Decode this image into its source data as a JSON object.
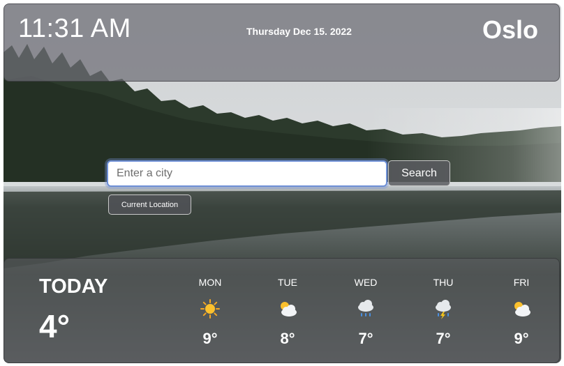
{
  "header": {
    "time": "11:31 AM",
    "date": "Thursday Dec 15. 2022",
    "city": "Oslo"
  },
  "search": {
    "placeholder": "Enter a city",
    "value": "",
    "button_label": "Search",
    "location_button_label": "Current Location"
  },
  "today": {
    "label": "TODAY",
    "temp": "4°"
  },
  "forecast": [
    {
      "day": "MON",
      "icon": "sun-icon",
      "temp": "9°"
    },
    {
      "day": "TUE",
      "icon": "sun-behind-cloud-icon",
      "temp": "8°"
    },
    {
      "day": "WED",
      "icon": "rain-cloud-icon",
      "temp": "7°"
    },
    {
      "day": "THU",
      "icon": "thunderstorm-icon",
      "temp": "7°"
    },
    {
      "day": "FRI",
      "icon": "sun-behind-cloud-icon",
      "temp": "9°"
    }
  ],
  "colors": {
    "panel": "#6e6e76",
    "input_focus": "#6d8fd6",
    "text": "#ffffff"
  }
}
